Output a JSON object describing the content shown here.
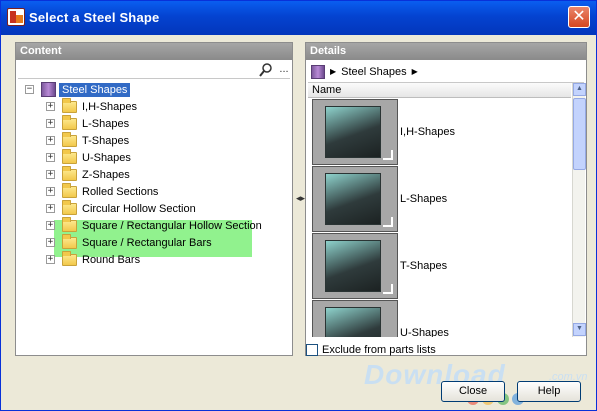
{
  "window": {
    "title": "Select a Steel Shape",
    "close_label": "✕"
  },
  "content": {
    "header": "Content",
    "search": {
      "value": "",
      "more_label": "..."
    },
    "tree": {
      "root": "Steel Shapes",
      "items": [
        {
          "label": "I,H-Shapes"
        },
        {
          "label": "L-Shapes"
        },
        {
          "label": "T-Shapes"
        },
        {
          "label": "U-Shapes"
        },
        {
          "label": "Z-Shapes"
        },
        {
          "label": "Rolled Sections"
        },
        {
          "label": "Circular Hollow Section"
        },
        {
          "label": "Square / Rectangular Hollow Section"
        },
        {
          "label": "Square / Rectangular Bars"
        },
        {
          "label": "Round Bars"
        }
      ]
    }
  },
  "details": {
    "header": "Details",
    "breadcrumb": "Steel Shapes",
    "column_header": "Name",
    "items": [
      {
        "label": "I,H-Shapes"
      },
      {
        "label": "L-Shapes"
      },
      {
        "label": "T-Shapes"
      },
      {
        "label": "U-Shapes"
      }
    ]
  },
  "footer": {
    "exclude_label": "Exclude from parts lists",
    "close_button": "Close",
    "help_button": "Help"
  },
  "watermark": {
    "text": "Download",
    "suffix": ".com.vn"
  },
  "colors": {
    "title_bar": "#0443d0",
    "selection": "#316ac5",
    "highlight": "#7ef07a"
  }
}
